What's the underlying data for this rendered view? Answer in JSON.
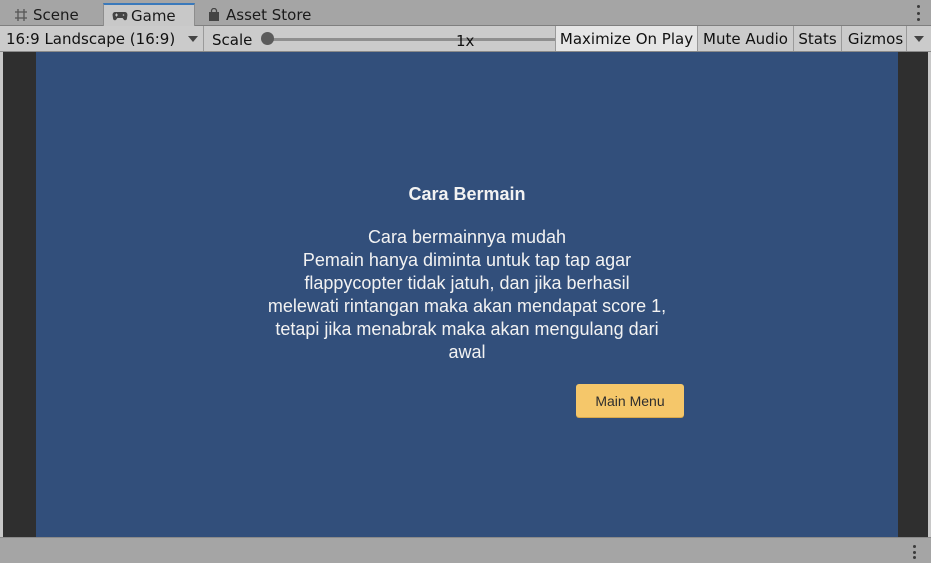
{
  "tabs": [
    {
      "label": "Scene",
      "icon": "grid-icon",
      "active": false
    },
    {
      "label": "Game",
      "icon": "gamepad-icon",
      "active": true
    },
    {
      "label": "Asset Store",
      "icon": "shopping-bag-icon",
      "active": false
    }
  ],
  "toolbar": {
    "aspect": "16:9 Landscape (16:9)",
    "scale_label": "Scale",
    "scale_value": "1x",
    "maximize_label": "Maximize On Play",
    "mute_label": "Mute Audio",
    "stats_label": "Stats",
    "gizmos_label": "Gizmos"
  },
  "game": {
    "title": "Cara Bermain",
    "body": "Cara bermainnya mudah\nPemain hanya diminta untuk tap tap agar flappycopter tidak jatuh, dan jika berhasil melewati rintangan maka akan mendapat score 1, tetapi jika menabrak maka akan mengulang dari awal",
    "button_label": "Main Menu"
  },
  "colors": {
    "game_background": "#324f7b",
    "button": "#f5c76a",
    "active_tab_accent": "#3a79bb"
  }
}
